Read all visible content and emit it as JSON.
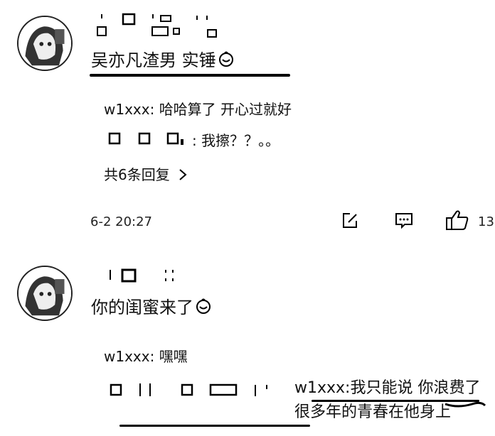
{
  "comments": [
    {
      "text": "吴亦凡渣男 实锤",
      "replies": [
        {
          "user": "w1xxx:",
          "text": "哈哈算了 开心过就好"
        },
        {
          "text": ": 我擦？？。。"
        }
      ],
      "more_replies": "共6条回复",
      "timestamp": "6-2 20:27",
      "like_count": "13"
    },
    {
      "text": "你的闺蜜来了",
      "replies": [
        {
          "user": "w1xxx:",
          "text": "嘿嘿"
        },
        {
          "user": "w1xxx:",
          "text": "我只能说 你浪费了很多年的青春在他身上"
        }
      ]
    }
  ],
  "icons": {
    "emoji": "smile-emoji-icon",
    "edit": "edit-icon",
    "comment": "comment-icon",
    "like": "thumbs-up-icon",
    "chevron": "chevron-right-icon"
  }
}
